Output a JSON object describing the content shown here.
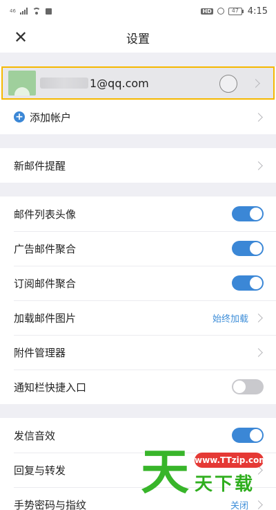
{
  "status_bar": {
    "signal_label": "46",
    "hd_label": "HD",
    "battery": "47",
    "time": "4:15"
  },
  "header": {
    "close_icon": "close-icon",
    "title": "设置"
  },
  "account": {
    "email": "1@qq.com",
    "add_account_label": "添加帐户"
  },
  "settings": {
    "new_mail_alert": "新邮件提醒",
    "list_avatar": {
      "label": "邮件列表头像",
      "on": true
    },
    "ad_aggregate": {
      "label": "广告邮件聚合",
      "on": true
    },
    "subscription_aggregate": {
      "label": "订阅邮件聚合",
      "on": true
    },
    "load_images": {
      "label": "加载邮件图片",
      "value": "始终加载"
    },
    "attachment_manager": "附件管理器",
    "notification_shortcut": {
      "label": "通知栏快捷入口",
      "on": false
    },
    "send_sound": {
      "label": "发信音效",
      "on": true
    },
    "reply_forward": "回复与转发",
    "gesture_password": {
      "label": "手势密码与指纹",
      "value": "关闭"
    }
  },
  "watermark": {
    "char": "天",
    "url": "www.TTzip.com",
    "text": "天下载"
  },
  "colors": {
    "accent": "#3b87d6",
    "highlight_border": "#f5b800",
    "watermark_green": "#38b52a",
    "watermark_red": "#e53935"
  }
}
